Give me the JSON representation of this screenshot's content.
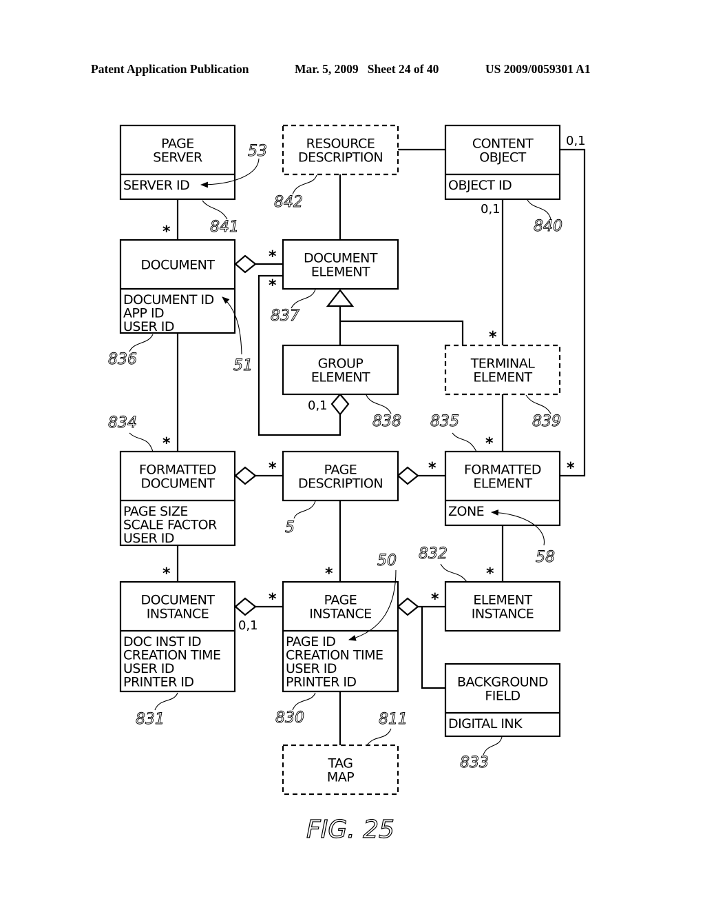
{
  "header": {
    "publication": "Patent Application Publication",
    "date_sheet": "Mar. 5, 2009   Sheet 24 of 40",
    "patent_number": "US 2009/0059301 A1"
  },
  "figure_label": "FIG. 25",
  "classes": {
    "page_server": {
      "title": [
        "PAGE",
        "SERVER"
      ],
      "attributes": [
        "SERVER ID"
      ],
      "ref": "841",
      "dashed": false
    },
    "resource_description": {
      "title": [
        "RESOURCE",
        "DESCRIPTION"
      ],
      "attributes": [],
      "ref": "842",
      "dashed": true
    },
    "content_object": {
      "title": [
        "CONTENT",
        "OBJECT"
      ],
      "attributes": [
        "OBJECT ID"
      ],
      "ref": "840",
      "dashed": false
    },
    "document": {
      "title": [
        "DOCUMENT"
      ],
      "attributes": [
        "DOCUMENT ID",
        "APP ID",
        "USER ID"
      ],
      "ref": "836",
      "dashed": false
    },
    "document_element": {
      "title": [
        "DOCUMENT",
        "ELEMENT"
      ],
      "attributes": [],
      "ref": "837",
      "dashed": false
    },
    "group_element": {
      "title": [
        "GROUP",
        "ELEMENT"
      ],
      "attributes": [],
      "ref": "838",
      "dashed": false
    },
    "terminal_element": {
      "title": [
        "TERMINAL",
        "ELEMENT"
      ],
      "attributes": [],
      "ref": "839",
      "dashed": true
    },
    "formatted_document": {
      "title": [
        "FORMATTED",
        "DOCUMENT"
      ],
      "attributes": [
        "PAGE SIZE",
        "SCALE FACTOR",
        "USER ID"
      ],
      "ref": "834",
      "dashed": false
    },
    "page_description": {
      "title": [
        "PAGE",
        "DESCRIPTION"
      ],
      "attributes": [],
      "ref": "5",
      "dashed": false
    },
    "formatted_element": {
      "title": [
        "FORMATTED",
        "ELEMENT"
      ],
      "attributes": [
        "ZONE"
      ],
      "ref": "835",
      "dashed": false
    },
    "document_instance": {
      "title": [
        "DOCUMENT",
        "INSTANCE"
      ],
      "attributes": [
        "DOC INST ID",
        "CREATION TIME",
        "USER ID",
        "PRINTER ID"
      ],
      "ref": "831",
      "dashed": false
    },
    "page_instance": {
      "title": [
        "PAGE",
        "INSTANCE"
      ],
      "attributes": [
        "PAGE ID",
        "CREATION TIME",
        "USER ID",
        "PRINTER ID"
      ],
      "ref": "830",
      "dashed": false
    },
    "element_instance": {
      "title": [
        "ELEMENT",
        "INSTANCE"
      ],
      "attributes": [],
      "ref": "832",
      "dashed": false
    },
    "background_field": {
      "title": [
        "BACKGROUND",
        "FIELD"
      ],
      "attributes": [
        "DIGITAL INK"
      ],
      "ref": "833",
      "dashed": false
    },
    "tag_map": {
      "title": [
        "TAG",
        "MAP"
      ],
      "attributes": [],
      "ref": "811",
      "dashed": true
    }
  },
  "attribute_refs": {
    "server_id": "53",
    "document_id": "51",
    "zone": "58",
    "page_id": "50"
  },
  "multiplicities": {
    "many": "*",
    "zero_or_one": "0,1"
  }
}
